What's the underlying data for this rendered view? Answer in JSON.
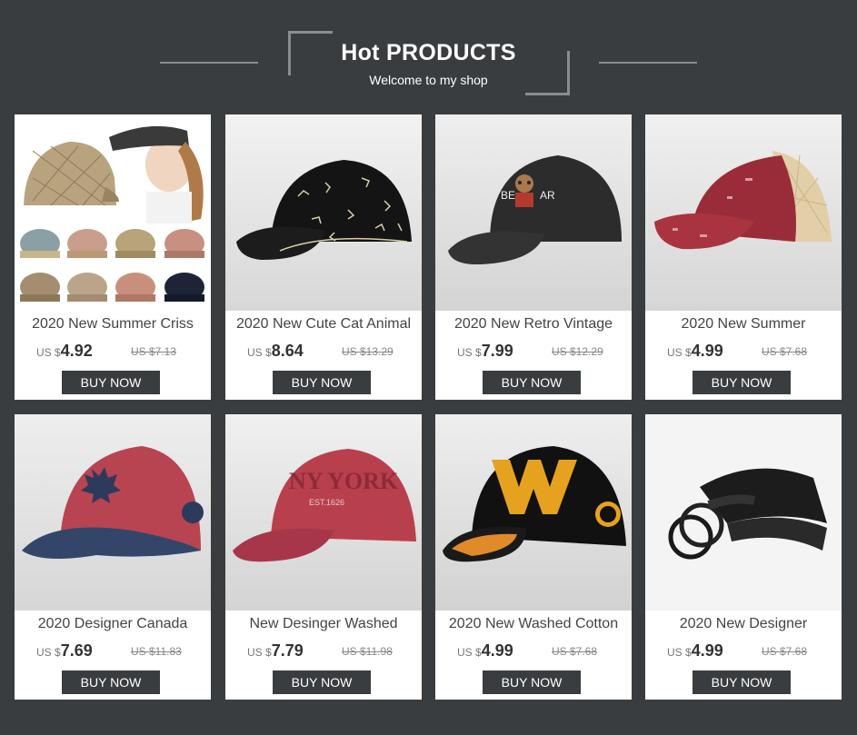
{
  "header": {
    "title": "Hot PRODUCTS",
    "subtitle": "Welcome to my shop"
  },
  "products": [
    {
      "name": "2020 New Summer Criss",
      "currency": "US $",
      "price": "4.92",
      "old_price": "US $7.13",
      "button": "BUY NOW",
      "image": "ponytail-mesh-cap-collage"
    },
    {
      "name": "2020 New Cute Cat Animal",
      "currency": "US $",
      "price": "8.64",
      "old_price": "US $13.29",
      "button": "BUY NOW",
      "image": "black-cat-print-cap"
    },
    {
      "name": "2020 New Retro Vintage",
      "currency": "US $",
      "price": "7.99",
      "old_price": "US $12.29",
      "button": "BUY NOW",
      "image": "black-bear-embroidery-cap"
    },
    {
      "name": "2020 New Summer",
      "currency": "US $",
      "price": "4.99",
      "old_price": "US $7.68",
      "button": "BUY NOW",
      "image": "red-distressed-mesh-cap"
    },
    {
      "name": "2020 Designer Canada",
      "currency": "US $",
      "price": "7.69",
      "old_price": "US $11.83",
      "button": "BUY NOW",
      "image": "red-navy-maple-leaf-cap"
    },
    {
      "name": "New Desinger Washed",
      "currency": "US $",
      "price": "7.79",
      "old_price": "US $11.98",
      "button": "BUY NOW",
      "image": "red-new-york-cap"
    },
    {
      "name": "2020 New Washed Cotton",
      "currency": "US $",
      "price": "4.99",
      "old_price": "US $7.68",
      "button": "BUY NOW",
      "image": "black-w-letter-cap"
    },
    {
      "name": "2020 New Designer",
      "currency": "US $",
      "price": "4.99",
      "old_price": "US $7.68",
      "button": "BUY NOW",
      "image": "black-double-ring-belt"
    }
  ],
  "colors": {
    "background": "#3a3d40",
    "card": "#ffffff",
    "button": "#3a3d40"
  }
}
